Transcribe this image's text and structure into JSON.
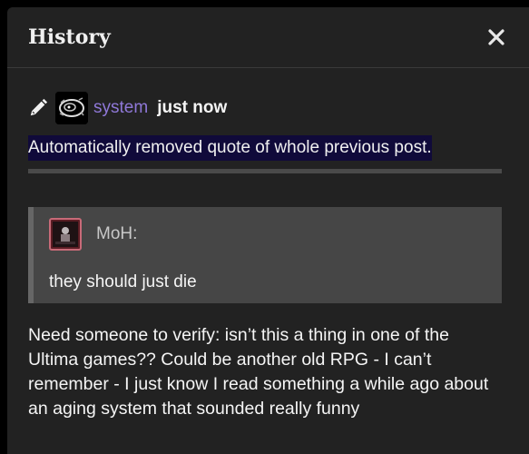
{
  "modal": {
    "title": "History"
  },
  "revision": {
    "username": "system",
    "time": "just now",
    "diff_text": "Automatically removed quote of whole previous post."
  },
  "quote": {
    "author": "MoH:",
    "text": "they should just die"
  },
  "post": {
    "body": "Need someone to verify: isn’t this a thing in one of the Ultima games?? Could be another old RPG - I can’t remember - I just know I read something a while ago about an aging system that sounded really funny"
  },
  "colors": {
    "background": "#222222",
    "username": "#8f78d8",
    "diff_highlight": "#100a3a",
    "quote_bg": "#464646"
  },
  "icons": {
    "edit": "pencil-icon",
    "close": "close-icon"
  }
}
